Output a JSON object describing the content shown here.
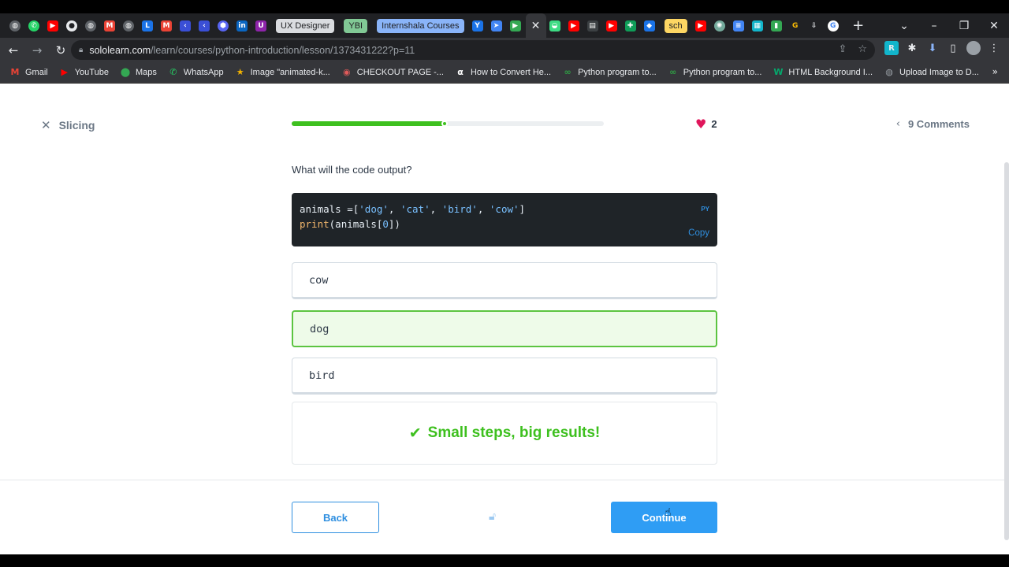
{
  "browser": {
    "tab_groups": [
      "UX Designer",
      "YBI",
      "Internshala Courses",
      "sch"
    ],
    "url_host": "sololearn.com",
    "url_path": "/learn/courses/python-introduction/lesson/1373431222?p=11",
    "bookmarks": [
      {
        "label": "Gmail",
        "icon": "gmail-icon",
        "color": "#ea4335"
      },
      {
        "label": "YouTube",
        "icon": "youtube-icon",
        "color": "#ff0000"
      },
      {
        "label": "Maps",
        "icon": "maps-icon",
        "color": "#34a853"
      },
      {
        "label": "WhatsApp",
        "icon": "whatsapp-icon",
        "color": "#25d366"
      },
      {
        "label": "Image \"animated-k...",
        "icon": "star-icon",
        "color": "#f4b400"
      },
      {
        "label": "CHECKOUT PAGE -...",
        "icon": "lips-icon",
        "color": "#e05a5a"
      },
      {
        "label": "How to Convert He...",
        "icon": "alpha-icon",
        "color": "#ffffff"
      },
      {
        "label": "Python program to...",
        "icon": "python-icon",
        "color": "#2f9e44"
      },
      {
        "label": "Python program to...",
        "icon": "python-icon",
        "color": "#2f9e44"
      },
      {
        "label": "HTML Background I...",
        "icon": "w3-icon",
        "color": "#04aa6d"
      },
      {
        "label": "Upload Image to D...",
        "icon": "globe-icon",
        "color": "#9aa0a6"
      }
    ],
    "bookmarks_more": "»"
  },
  "lesson": {
    "title": "Slicing",
    "progress": 0.49,
    "hearts": "2",
    "comments": "9 Comments"
  },
  "question": {
    "prompt": "What will the code output?",
    "code_line1_parts": [
      "animals =[",
      "'dog'",
      ", ",
      "'cat'",
      ", ",
      "'bird'",
      ", ",
      "'cow'",
      "]"
    ],
    "code_line2_parts": [
      "print",
      "(animals[",
      "0",
      "])"
    ],
    "lang": "PY",
    "copy_label": "Copy",
    "options": [
      {
        "label": "cow",
        "state": "default"
      },
      {
        "label": "dog",
        "state": "correct"
      },
      {
        "label": "bird",
        "state": "default"
      }
    ],
    "feedback": "Small steps, big results!"
  },
  "footer": {
    "back_label": "Back",
    "continue_label": "Continue"
  },
  "colors": {
    "accent_blue": "#2f9df4",
    "success_green": "#3ec01f",
    "heart": "#e0165b"
  }
}
